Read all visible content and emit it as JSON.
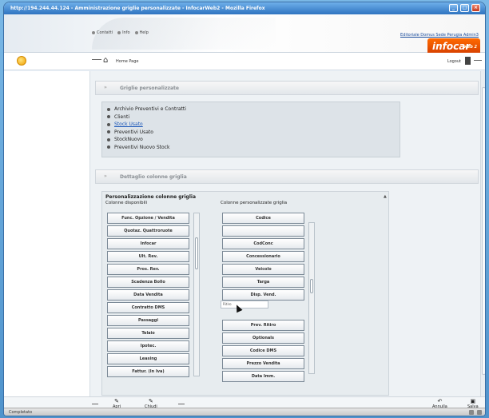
{
  "window": {
    "title": "http://194.244.44.124 - Amministrazione griglie personalizzate - InfocarWeb2 - Mozilla Firefox"
  },
  "banner": {
    "top_links": [
      "Contatti",
      "Info",
      "Help"
    ],
    "right_link": "Editoriale Domus Sede Perugia Admin3",
    "logo_text": "infocar",
    "logo_sub": "web 2"
  },
  "nav": {
    "home_label": "Home Page",
    "logout_label": "Logout"
  },
  "sections": {
    "grids_title": "Griglie personalizzate",
    "detail_title": "Dettaglio colonne griglia"
  },
  "grid_list": [
    {
      "label": "Archivio Preventivi e Contratti"
    },
    {
      "label": "Clienti"
    },
    {
      "label": "Stock Usato"
    },
    {
      "label": "Preventivi Usato"
    },
    {
      "label": "StockNuovo"
    },
    {
      "label": "Preventivi Nuovo Stock"
    }
  ],
  "detail": {
    "heading": "Personalizzazione colonne griglia",
    "available_label": "Colonne disponibili",
    "custom_label": "Colonne personalizzate griglia",
    "available_columns": [
      "Func. Opzione / Vendita",
      "Quotaz. Quattroruote",
      "Infocar",
      "Ult. Rev.",
      "Pros. Rev.",
      "Scadenza Bollo",
      "Data Vendita",
      "Contratto DMS",
      "Passaggi",
      "Telaio",
      "Ipotec.",
      "Leasing",
      "Fattur. (In Iva)"
    ],
    "custom_columns_top": [
      "Codice",
      "",
      "CodConc",
      "Concessionario",
      "Veicolo",
      "Targa",
      "Disp. Vend."
    ],
    "drop_tooltip": "Ritiro",
    "custom_columns_bottom": [
      "Prev. Ritiro",
      "Optionals",
      "Codice DMS",
      "Prezzo Vendita",
      "Data Imm."
    ]
  },
  "footer": {
    "apri_label": "Apri",
    "chiudi_label": "Chiudi",
    "annulla_label": "Annulla",
    "salva_label": "Salva"
  },
  "status": {
    "text": "Completato"
  }
}
